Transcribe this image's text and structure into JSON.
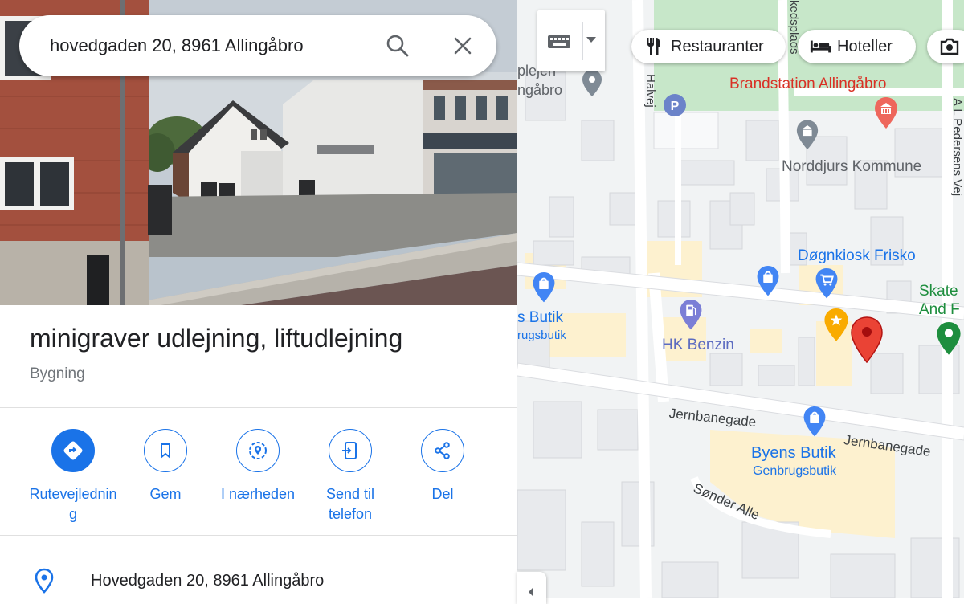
{
  "search": {
    "query": "hovedgaden 20, 8961 Allingåbro"
  },
  "place": {
    "title": "minigraver udlejning, liftudlejning",
    "category": "Bygning"
  },
  "actions": [
    {
      "label": "Rutevejledning"
    },
    {
      "label": "Gem"
    },
    {
      "label": "I nærheden"
    },
    {
      "label": "Send til telefon"
    },
    {
      "label": "Del"
    }
  ],
  "address": {
    "text": "Hovedgaden 20, 8961 Allingåbro"
  },
  "map_chips": [
    {
      "label": "Restauranter",
      "icon": "fork-knife-icon"
    },
    {
      "label": "Hoteller",
      "icon": "bed-icon"
    },
    {
      "label": "",
      "icon": "camera-icon"
    }
  ],
  "map_labels": {
    "brandstation": "Brandstation Allingåbro",
    "kommune": "Norddjurs Kommune",
    "dognkiosk": "Døgnkiosk Frisko",
    "skate1": "Skate",
    "skate2": "And F",
    "hk_benzin": "HK Benzin",
    "byens_butik": "Byens Butik",
    "genbrugsbutik": "Genbrugsbutik",
    "s_butik": "s Butik",
    "rugsbutik": "rugsbutik",
    "pleje1": "plejen",
    "pleje2": "ngåbro",
    "jernbanegade": "Jernbanegade",
    "sonder_alle": "Sønder Alle",
    "halvej": "Halvej",
    "kedsplads": "kedsplads",
    "al_pedersens": "A L Pedersens Vej"
  },
  "colors": {
    "accent": "#1a73e8",
    "pin_red": "#ea4335",
    "poi_blue": "#4285f4",
    "poi_purple": "#7b7ed6",
    "star_gold": "#f9ab00",
    "poi_green": "#1e8e3e",
    "park_green": "#c7e7c9",
    "commercial_yellow": "#fdf1cf"
  }
}
